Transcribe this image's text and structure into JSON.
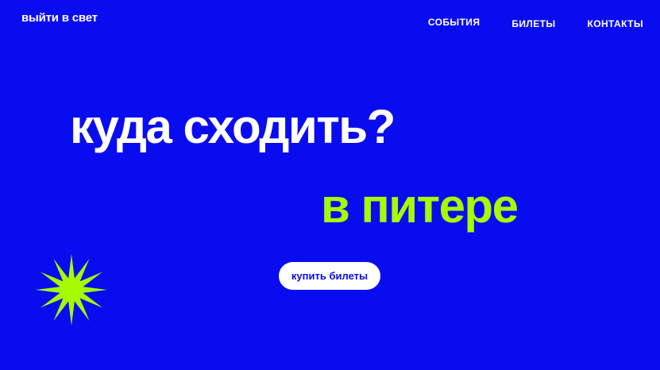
{
  "header": {
    "logo_text": "выйти в свет",
    "nav": [
      {
        "label": "СОБЫТИЯ"
      },
      {
        "label": "БИЛЕТЫ"
      },
      {
        "label": "КОНТАКТЫ"
      }
    ]
  },
  "hero": {
    "headline_line1": "куда сходить?",
    "headline_line2": "в питере",
    "cta_label": "купить билеты"
  },
  "decor": {
    "star_icon": "starburst-icon"
  },
  "colors": {
    "background": "#0a0cf0",
    "accent": "#a4fb04",
    "text": "#ffffff"
  }
}
